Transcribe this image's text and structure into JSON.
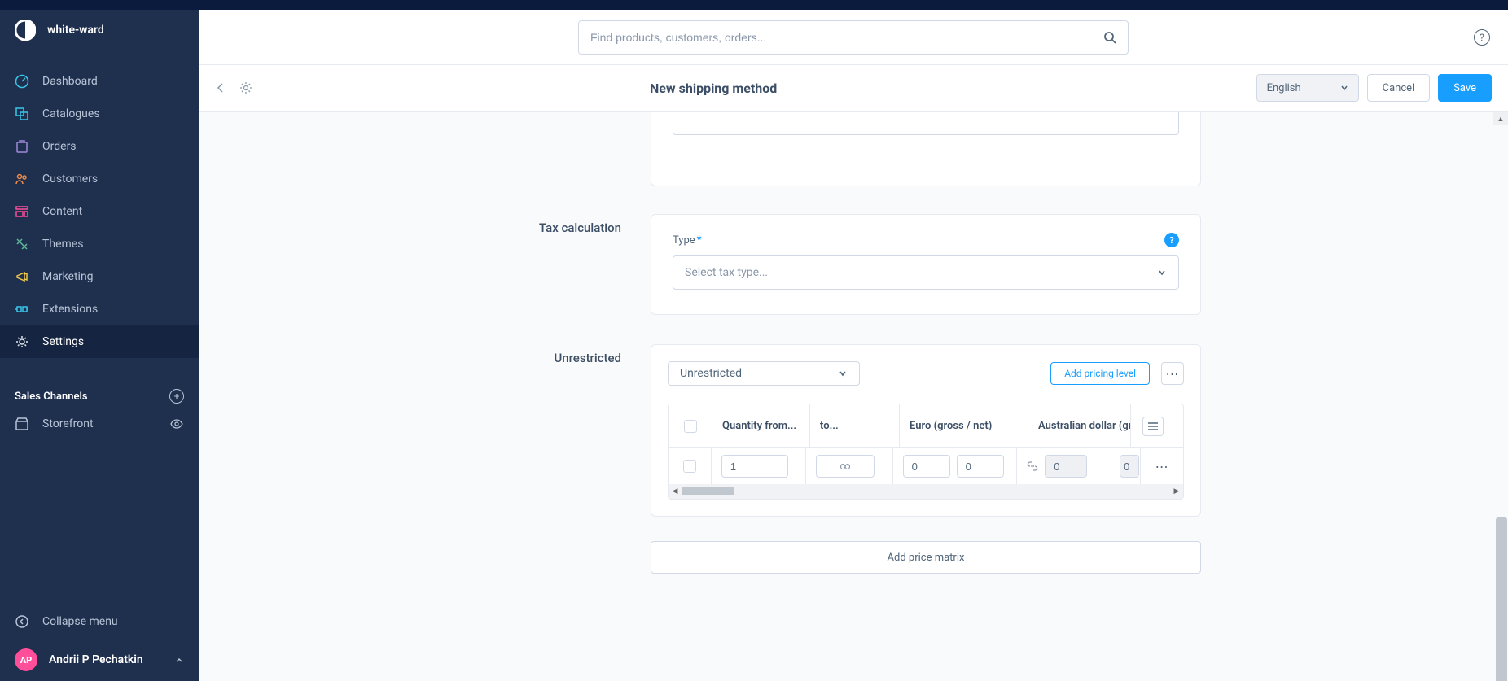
{
  "brand": {
    "name": "white-ward"
  },
  "nav": {
    "dashboard": "Dashboard",
    "catalogues": "Catalogues",
    "orders": "Orders",
    "customers": "Customers",
    "content": "Content",
    "themes": "Themes",
    "marketing": "Marketing",
    "extensions": "Extensions",
    "settings": "Settings"
  },
  "salesChannels": {
    "title": "Sales Channels",
    "storefront": "Storefront"
  },
  "collapse": "Collapse menu",
  "user": {
    "initials": "AP",
    "name": "Andrii P Pechatkin"
  },
  "search": {
    "placeholder": "Find products, customers, orders..."
  },
  "page": {
    "title": "New shipping method",
    "language": "English",
    "cancel": "Cancel",
    "save": "Save"
  },
  "tax": {
    "sectionLabel": "Tax calculation",
    "typeLabel": "Type",
    "placeholder": "Select tax type..."
  },
  "matrix": {
    "sectionLabel": "Unrestricted",
    "selectValue": "Unrestricted",
    "addPricingLevel": "Add pricing level",
    "headers": {
      "qty": "Quantity from...",
      "to": "to...",
      "euro": "Euro (gross / net)",
      "aud": "Australian dollar (gro"
    },
    "row": {
      "qty": "1",
      "to": "∞",
      "euroGross": "0",
      "euroNet": "0",
      "audGross": "0",
      "audNet": "0"
    },
    "addMatrix": "Add price matrix"
  }
}
